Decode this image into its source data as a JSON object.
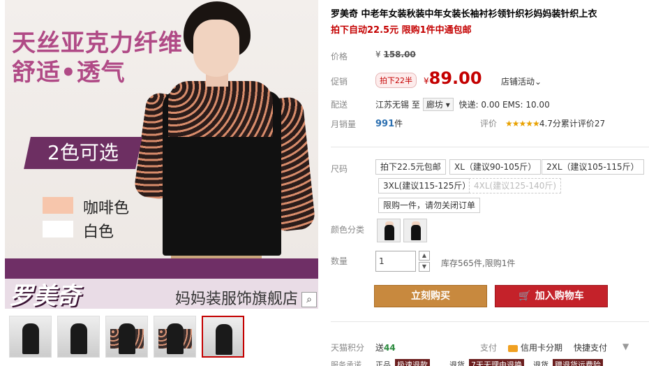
{
  "gallery": {
    "main_image": {
      "slogan_line1": "天丝亚克力纤维",
      "slogan_line2": "舒适•透气",
      "colors_badge": "2色可选",
      "swatches": [
        {
          "label": "咖啡色",
          "color": "#f7c6ac"
        },
        {
          "label": "白色",
          "color": "#ffffff"
        }
      ],
      "brand_name": "罗美奇",
      "store_name": "妈妈装服饰旗舰店",
      "zoom_icon": "magnifier-icon"
    },
    "thumbnails_count": 5,
    "active_thumbnail": 4
  },
  "product": {
    "title": "罗美奇 中老年女装秋装中年女装长袖衬衫领针织衫妈妈装针织上衣",
    "subtitle": "拍下自动22.5元 限购1件中通包邮",
    "price_label": "价格",
    "original_price_symbol": "¥",
    "original_price": "158.00",
    "promo_label": "促销",
    "promo_tag": "拍下22半",
    "promo_price_symbol": "¥",
    "promo_price": "89.00",
    "shop_activity": "店铺活动",
    "delivery_label": "配送",
    "delivery_from": "江苏无锡",
    "delivery_to_word": "至",
    "delivery_city": "廊坊",
    "delivery_fee": "快递: 0.00 EMS: 10.00",
    "monthly_sales_label": "月销量",
    "monthly_sales_value": "991",
    "monthly_sales_unit": "件",
    "rating_label": "评价",
    "rating_stars": "★★★★★",
    "rating_value": "4.7分",
    "rating_count_text": "累计评价27",
    "size_label": "尺码",
    "size_options": [
      "拍下22.5元包邮",
      "XL（建议90-105斤）",
      "2XL（建议105-115斤）",
      "3XL(建议115-125斤）",
      "4XL(建议125-140斤)",
      "限购一件，请勿关闭订单"
    ],
    "color_label": "颜色分类",
    "quantity_label": "数量",
    "quantity_value": "1",
    "stock_text": "库存565件,限购1件",
    "buy_now": "立刻购买",
    "add_to_cart": "加入购物车",
    "tmall_points_label": "天猫积分",
    "tmall_points_prefix": "送",
    "tmall_points_value": "44",
    "payment_label": "支付",
    "credit_card": "信用卡分期",
    "fast_pay": "快捷支付",
    "more_arrow": "▼",
    "bottom_partial": [
      "服务承诺",
      "正品",
      "极速退款",
      "退货",
      "7天无理由退换",
      "退货",
      "赠退货运费险"
    ]
  }
}
